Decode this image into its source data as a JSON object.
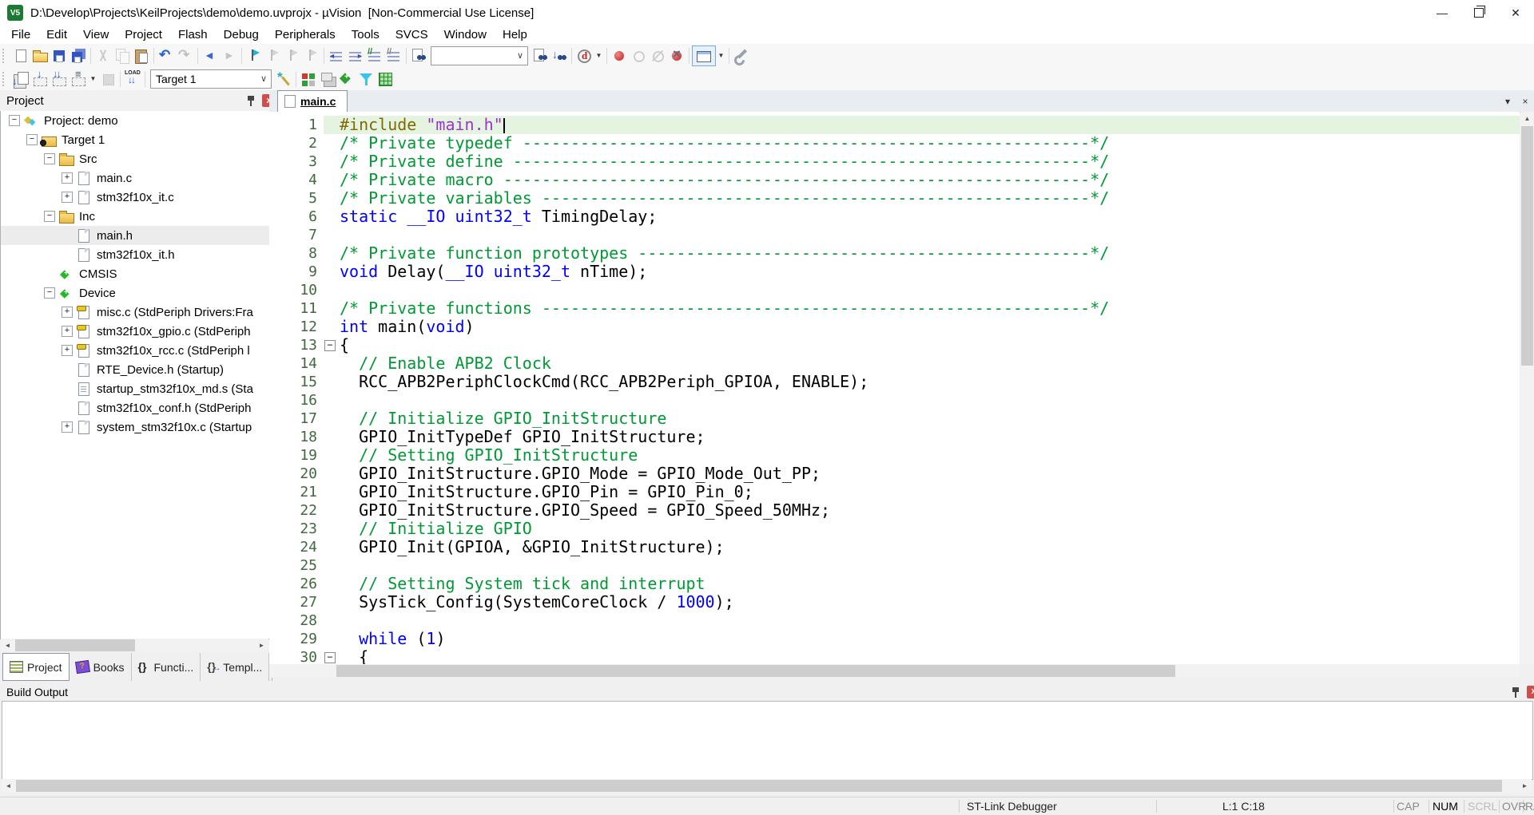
{
  "window": {
    "title": "D:\\Develop\\Projects\\KeilProjects\\demo\\demo.uvprojx - µVision  [Non-Commercial Use License]",
    "app_icon_label": "V5",
    "controls": {
      "minimize": "—",
      "close": "✕"
    }
  },
  "menu": {
    "items": [
      "File",
      "Edit",
      "View",
      "Project",
      "Flash",
      "Debug",
      "Peripherals",
      "Tools",
      "SVCS",
      "Window",
      "Help"
    ]
  },
  "toolbar1": {
    "items": [
      {
        "kind": "btn",
        "name": "new-file"
      },
      {
        "kind": "btn",
        "name": "open-file"
      },
      {
        "kind": "btn",
        "name": "save"
      },
      {
        "kind": "btn",
        "name": "save-all"
      },
      {
        "kind": "sep"
      },
      {
        "kind": "btn",
        "name": "cut",
        "disabled": true
      },
      {
        "kind": "btn",
        "name": "copy",
        "disabled": true
      },
      {
        "kind": "btn",
        "name": "paste"
      },
      {
        "kind": "sep"
      },
      {
        "kind": "btn",
        "name": "undo"
      },
      {
        "kind": "btn",
        "name": "redo",
        "disabled": true
      },
      {
        "kind": "sep"
      },
      {
        "kind": "btn",
        "name": "navigate-back"
      },
      {
        "kind": "btn",
        "name": "navigate-forward",
        "disabled": true
      },
      {
        "kind": "sep"
      },
      {
        "kind": "btn",
        "name": "toggle-bookmark",
        "cls": "ic-flag"
      },
      {
        "kind": "btn",
        "name": "prev-bookmark",
        "cls": "ic-flag",
        "disabled": true
      },
      {
        "kind": "btn",
        "name": "next-bookmark",
        "cls": "ic-flag",
        "disabled": true
      },
      {
        "kind": "btn",
        "name": "clear-bookmarks",
        "cls": "ic-flag",
        "disabled": true
      },
      {
        "kind": "sep"
      },
      {
        "kind": "btn",
        "name": "unindent",
        "cls": "ic-lines ic-unindent"
      },
      {
        "kind": "btn",
        "name": "indent",
        "cls": "ic-lines ic-indent"
      },
      {
        "kind": "btn",
        "name": "comment",
        "cls": "ic-lines ic-comment"
      },
      {
        "kind": "btn",
        "name": "uncomment",
        "cls": "ic-lines ic-uncomment"
      },
      {
        "kind": "sep"
      },
      {
        "kind": "btn",
        "name": "find-in-files",
        "cls": "ic-page ic-binocs"
      },
      {
        "kind": "combo",
        "name": "find-text",
        "value": "",
        "width": 120
      },
      {
        "kind": "btn",
        "name": "find-next",
        "cls": "ic-page ic-binocs"
      },
      {
        "kind": "btn",
        "name": "incremental-find",
        "cls": "ic-incremental-find ic-binocs"
      },
      {
        "kind": "sep"
      },
      {
        "kind": "btn",
        "name": "lookup-symbol",
        "dropdown": true
      },
      {
        "kind": "sep"
      },
      {
        "kind": "btn",
        "name": "insert-breakpoint",
        "cls": "ic-dot"
      },
      {
        "kind": "btn",
        "name": "enable-breakpoint",
        "cls": "ic-dot-hollow",
        "disabled": true
      },
      {
        "kind": "btn",
        "name": "disable-all-breakpoints",
        "cls": "ic-dot-hollow ic-dot-slash",
        "disabled": true
      },
      {
        "kind": "btn",
        "name": "kill-all-breakpoints",
        "cls": "ic-dot ic-dot-x"
      },
      {
        "kind": "sep"
      },
      {
        "kind": "btn",
        "name": "debug-windows",
        "dropdown": true,
        "framed": true
      },
      {
        "kind": "sep"
      },
      {
        "kind": "btn",
        "name": "configure-tools"
      }
    ]
  },
  "toolbar2": {
    "items": [
      {
        "kind": "btn",
        "name": "translate-file"
      },
      {
        "kind": "btn",
        "name": "build",
        "cls": "ic-dashbox ic-build"
      },
      {
        "kind": "btn",
        "name": "rebuild-all",
        "cls": "ic-dashbox ic-rebuild-all"
      },
      {
        "kind": "btn",
        "name": "batch-build",
        "cls": "ic-dashbox ic-batch-build",
        "dropdown": true
      },
      {
        "kind": "btn",
        "name": "stop-build",
        "disabled": true
      },
      {
        "kind": "sep"
      },
      {
        "kind": "btn",
        "name": "download-flash"
      },
      {
        "kind": "sep"
      },
      {
        "kind": "combo",
        "name": "target-select",
        "value": "Target 1",
        "width": 150
      },
      {
        "kind": "btn",
        "name": "options-for-target"
      },
      {
        "kind": "sep"
      },
      {
        "kind": "btn",
        "name": "manage-rte"
      },
      {
        "kind": "btn",
        "name": "multi-project-workspace"
      },
      {
        "kind": "btn",
        "name": "pack-update"
      },
      {
        "kind": "btn",
        "name": "file-filter"
      },
      {
        "kind": "btn",
        "name": "pack-installer"
      }
    ]
  },
  "project_panel": {
    "title": "Project",
    "tree": [
      {
        "label": "Project: demo",
        "icon": "project",
        "exp": "minus",
        "depth": 0
      },
      {
        "label": "Target 1",
        "icon": "target-folder",
        "exp": "minus",
        "depth": 1
      },
      {
        "label": "Src",
        "icon": "folder",
        "exp": "minus",
        "depth": 2
      },
      {
        "label": "main.c",
        "icon": "file-c",
        "exp": "plus",
        "depth": 3
      },
      {
        "label": "stm32f10x_it.c",
        "icon": "file-c",
        "exp": "plus",
        "depth": 3
      },
      {
        "label": "Inc",
        "icon": "folder",
        "exp": "minus",
        "depth": 2
      },
      {
        "label": "main.h",
        "icon": "file-h",
        "exp": null,
        "depth": 3,
        "selected": true
      },
      {
        "label": "stm32f10x_it.h",
        "icon": "file-h",
        "exp": null,
        "depth": 3
      },
      {
        "label": "CMSIS",
        "icon": "diamond",
        "exp": null,
        "depth": 2
      },
      {
        "label": "Device",
        "icon": "diamond",
        "exp": "minus",
        "depth": 2
      },
      {
        "label": "misc.c (StdPeriph Drivers:Fra",
        "icon": "file-key",
        "exp": "plus",
        "depth": 3
      },
      {
        "label": "stm32f10x_gpio.c (StdPeriph",
        "icon": "file-key",
        "exp": "plus",
        "depth": 3
      },
      {
        "label": "stm32f10x_rcc.c (StdPeriph l",
        "icon": "file-key",
        "exp": "plus",
        "depth": 3
      },
      {
        "label": "RTE_Device.h (Startup)",
        "icon": "file-h",
        "exp": null,
        "depth": 3
      },
      {
        "label": "startup_stm32f10x_md.s (Sta",
        "icon": "file-asm",
        "exp": null,
        "depth": 3
      },
      {
        "label": "stm32f10x_conf.h (StdPeriph",
        "icon": "file-h",
        "exp": null,
        "depth": 3
      },
      {
        "label": "system_stm32f10x.c (Startup",
        "icon": "file-c",
        "exp": "plus",
        "depth": 3
      }
    ],
    "tabs": [
      {
        "label": "Project",
        "icon": "project-tab",
        "active": true
      },
      {
        "label": "Books",
        "icon": "books-tab",
        "active": false
      },
      {
        "label": "Functi...",
        "icon": "functions-tab",
        "active": false
      },
      {
        "label": "Templ...",
        "icon": "templates-tab",
        "active": false
      }
    ]
  },
  "editor": {
    "tab_label": "main.c",
    "dropdown_glyph": "▾",
    "close_glyph": "×",
    "lines": [
      {
        "n": 1,
        "cur": true,
        "caret": true,
        "segs": [
          [
            "p",
            "#include "
          ],
          [
            "s",
            "\"main.h\""
          ]
        ]
      },
      {
        "n": 2,
        "segs": [
          [
            "c",
            "/* Private typedef -----------------------------------------------------------*/"
          ]
        ]
      },
      {
        "n": 3,
        "segs": [
          [
            "c",
            "/* Private define ------------------------------------------------------------*/"
          ]
        ]
      },
      {
        "n": 4,
        "segs": [
          [
            "c",
            "/* Private macro -------------------------------------------------------------*/"
          ]
        ]
      },
      {
        "n": 5,
        "segs": [
          [
            "c",
            "/* Private variables ---------------------------------------------------------*/"
          ]
        ]
      },
      {
        "n": 6,
        "segs": [
          [
            "k",
            "static __IO uint32_t"
          ],
          [
            "t",
            " TimingDelay;"
          ]
        ]
      },
      {
        "n": 7,
        "segs": []
      },
      {
        "n": 8,
        "segs": [
          [
            "c",
            "/* Private function prototypes -----------------------------------------------*/"
          ]
        ]
      },
      {
        "n": 9,
        "segs": [
          [
            "k",
            "void"
          ],
          [
            "t",
            " Delay("
          ],
          [
            "k",
            "__IO uint32_t"
          ],
          [
            "t",
            " nTime);"
          ]
        ]
      },
      {
        "n": 10,
        "segs": []
      },
      {
        "n": 11,
        "segs": [
          [
            "c",
            "/* Private functions ---------------------------------------------------------*/"
          ]
        ]
      },
      {
        "n": 12,
        "segs": [
          [
            "k",
            "int"
          ],
          [
            "t",
            " main("
          ],
          [
            "k",
            "void"
          ],
          [
            "t",
            ")"
          ]
        ]
      },
      {
        "n": 13,
        "fold": "minus",
        "segs": [
          [
            "t",
            "{"
          ]
        ]
      },
      {
        "n": 14,
        "segs": [
          [
            "t",
            "  "
          ],
          [
            "c",
            "// Enable APB2 Clock"
          ]
        ]
      },
      {
        "n": 15,
        "segs": [
          [
            "t",
            "  RCC_APB2PeriphClockCmd(RCC_APB2Periph_GPIOA, ENABLE);"
          ]
        ]
      },
      {
        "n": 16,
        "segs": []
      },
      {
        "n": 17,
        "segs": [
          [
            "t",
            "  "
          ],
          [
            "c",
            "// Initialize GPIO_InitStructure"
          ]
        ]
      },
      {
        "n": 18,
        "segs": [
          [
            "t",
            "  GPIO_InitTypeDef GPIO_InitStructure;"
          ]
        ]
      },
      {
        "n": 19,
        "segs": [
          [
            "t",
            "  "
          ],
          [
            "c",
            "// Setting GPIO_InitStructure"
          ]
        ]
      },
      {
        "n": 20,
        "segs": [
          [
            "t",
            "  GPIO_InitStructure.GPIO_Mode = GPIO_Mode_Out_PP;"
          ]
        ]
      },
      {
        "n": 21,
        "segs": [
          [
            "t",
            "  GPIO_InitStructure.GPIO_Pin = GPIO_Pin_0;"
          ]
        ]
      },
      {
        "n": 22,
        "segs": [
          [
            "t",
            "  GPIO_InitStructure.GPIO_Speed = GPIO_Speed_50MHz;"
          ]
        ]
      },
      {
        "n": 23,
        "segs": [
          [
            "t",
            "  "
          ],
          [
            "c",
            "// Initialize GPIO"
          ]
        ]
      },
      {
        "n": 24,
        "segs": [
          [
            "t",
            "  GPIO_Init(GPIOA, &GPIO_InitStructure);"
          ]
        ]
      },
      {
        "n": 25,
        "segs": []
      },
      {
        "n": 26,
        "segs": [
          [
            "t",
            "  "
          ],
          [
            "c",
            "// Setting System tick and interrupt"
          ]
        ]
      },
      {
        "n": 27,
        "segs": [
          [
            "t",
            "  SysTick_Config(SystemCoreClock / "
          ],
          [
            "n2",
            "1000"
          ],
          [
            "t",
            ");"
          ]
        ]
      },
      {
        "n": 28,
        "segs": []
      },
      {
        "n": 29,
        "segs": [
          [
            "t",
            "  "
          ],
          [
            "k",
            "while"
          ],
          [
            "t",
            " ("
          ],
          [
            "n2",
            "1"
          ],
          [
            "t",
            ")"
          ]
        ]
      },
      {
        "n": 30,
        "fold": "minus",
        "segs": [
          [
            "t",
            "  {"
          ]
        ]
      }
    ]
  },
  "build_output": {
    "title": "Build Output",
    "content": ""
  },
  "status_bar": {
    "debugger_label": "ST-Link Debugger",
    "cursor_pos": "L:1 C:18",
    "toggles": [
      {
        "label": "CAP",
        "state": "dim"
      },
      {
        "label": "NUM",
        "state": "on"
      },
      {
        "label": "SCRL",
        "state": "off"
      },
      {
        "label": "OVR",
        "state": "dim"
      },
      {
        "label": "R/W",
        "state": "dim"
      }
    ]
  }
}
